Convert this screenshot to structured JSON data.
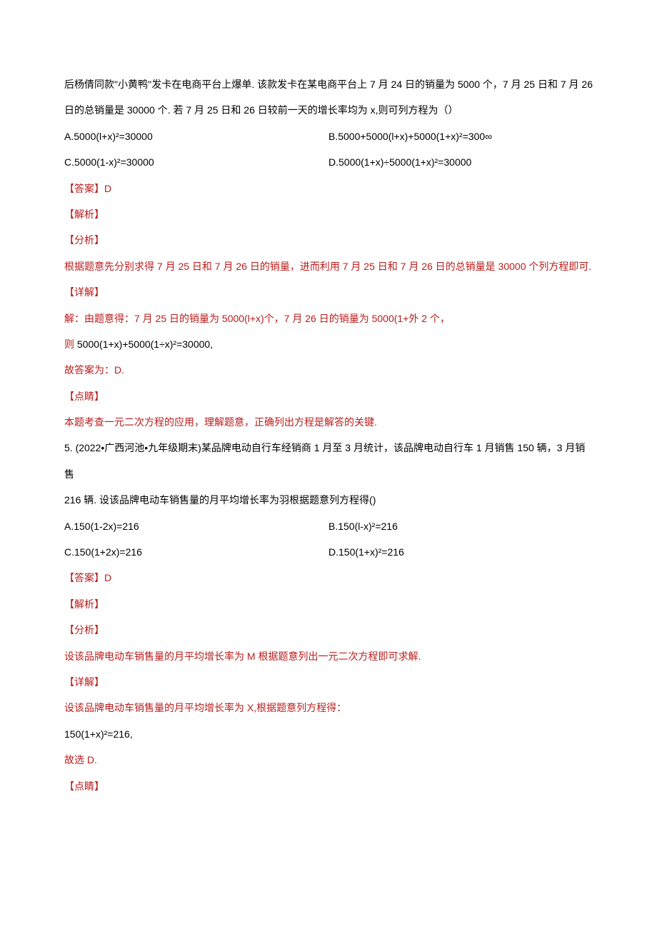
{
  "q4": {
    "stem1": "后杨倩同款\"小黄鸭''发卡在电商平台上爆单. 该款发卡在某电商平台上 7 月 24 日的销量为 5000 个，7 月 25 日和 7 月 26",
    "stem2": "日的总销量是 30000 个. 若 7 月 25 日和 26 日较前一天的增长率均为 x,则可列方程为（）",
    "optA": "A.5000(l+x)²=30000",
    "optB": "B.5000+5000(l+x)+5000(1+x)²=300∞",
    "optC": "C.5000(1-x)²=30000",
    "optD": "D.5000(1+x)÷5000(1+x)²=30000",
    "answerLabel": "【答案】D",
    "jxLabel": "【解析】",
    "fxLabel": "【分析】",
    "fxText": "根据题意先分别求得 7 月 25 日和 7 月 26 日的销量，进而利用 7 月 25 日和 7 月 26 日的总销量是 30000 个列方程即可.",
    "xjLabel": "【详解】",
    "xjLine1": "解：由题意得：7 月 25 日的销量为 5000(l+x)个，7 月 26 日的销量为 5000(1+外 2 个，",
    "xjLine2Prefix": "则",
    "xjLine2": "5000(1+x)+5000(1÷x)²=30000,",
    "xjLine3": "故答案为：D.",
    "djLabel": "【点睛】",
    "djText": "本题考查一元二次方程的应用，理解题意，正确列出方程是解答的关键."
  },
  "q5": {
    "stem1": "5.    (2022•广西河池•九年级期末)某品牌电动自行车经销商 1 月至 3 月统计，该品牌电动自行车 1 月销售 150 辆，3 月销售",
    "stem2": "216 辆. 设该品牌电动车销售量的月平均增长率为羽根据题意列方程得()",
    "optA": "A.150(1-2x)=216",
    "optB": "B.150(l-x)²=216",
    "optC": "C.150(1+2x)=216",
    "optD": "D.150(1+x)²=216",
    "answerLabel": "【答案】D",
    "jxLabel": "【解析】",
    "fxLabel": "【分析】",
    "fxText": "设该品牌电动车销售量的月平均增长率为 M 根据题意列出一元二次方程即可求解.",
    "xjLabel": "【详解】",
    "xjLine1": "设该品牌电动车销售量的月平均增长率为 X,根据题意列方程得：",
    "xjLine2": "150(1+x)²=216,",
    "xjLine3": "故选 D.",
    "djLabel": "【点睛】"
  }
}
